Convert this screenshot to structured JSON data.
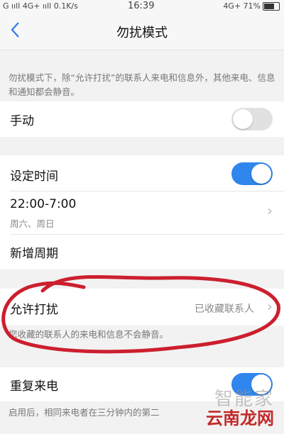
{
  "status_bar": {
    "left": "G ııll 4G+ ııll 0.1K/s",
    "time": "16:39",
    "right": "4G+ 71%"
  },
  "header": {
    "back_icon": "chevron-left-icon",
    "title": "勿扰模式"
  },
  "intro_text": "勿扰模式下，除“允许打扰”的联系人来电和信息外，其他来电、信息和通知都会静音。",
  "manual": {
    "label": "手动",
    "enabled": false
  },
  "schedule": {
    "label": "设定时间",
    "enabled": true,
    "time_range": "22:00-7:00",
    "days": "周六、周日",
    "add_period": "新增周期"
  },
  "allow": {
    "label": "允许打扰",
    "value": "已收藏联系人",
    "desc": "您收藏的联系人的来电和信息不会静音。"
  },
  "repeat": {
    "label": "重复来电",
    "enabled": true,
    "desc": "启用后，相同来电者在三分钟内的第二"
  },
  "watermark": {
    "top": "智能家",
    "bottom": "云南龙网"
  },
  "colors": {
    "accent": "#2f86ec",
    "annotation": "#cc1f2e"
  }
}
